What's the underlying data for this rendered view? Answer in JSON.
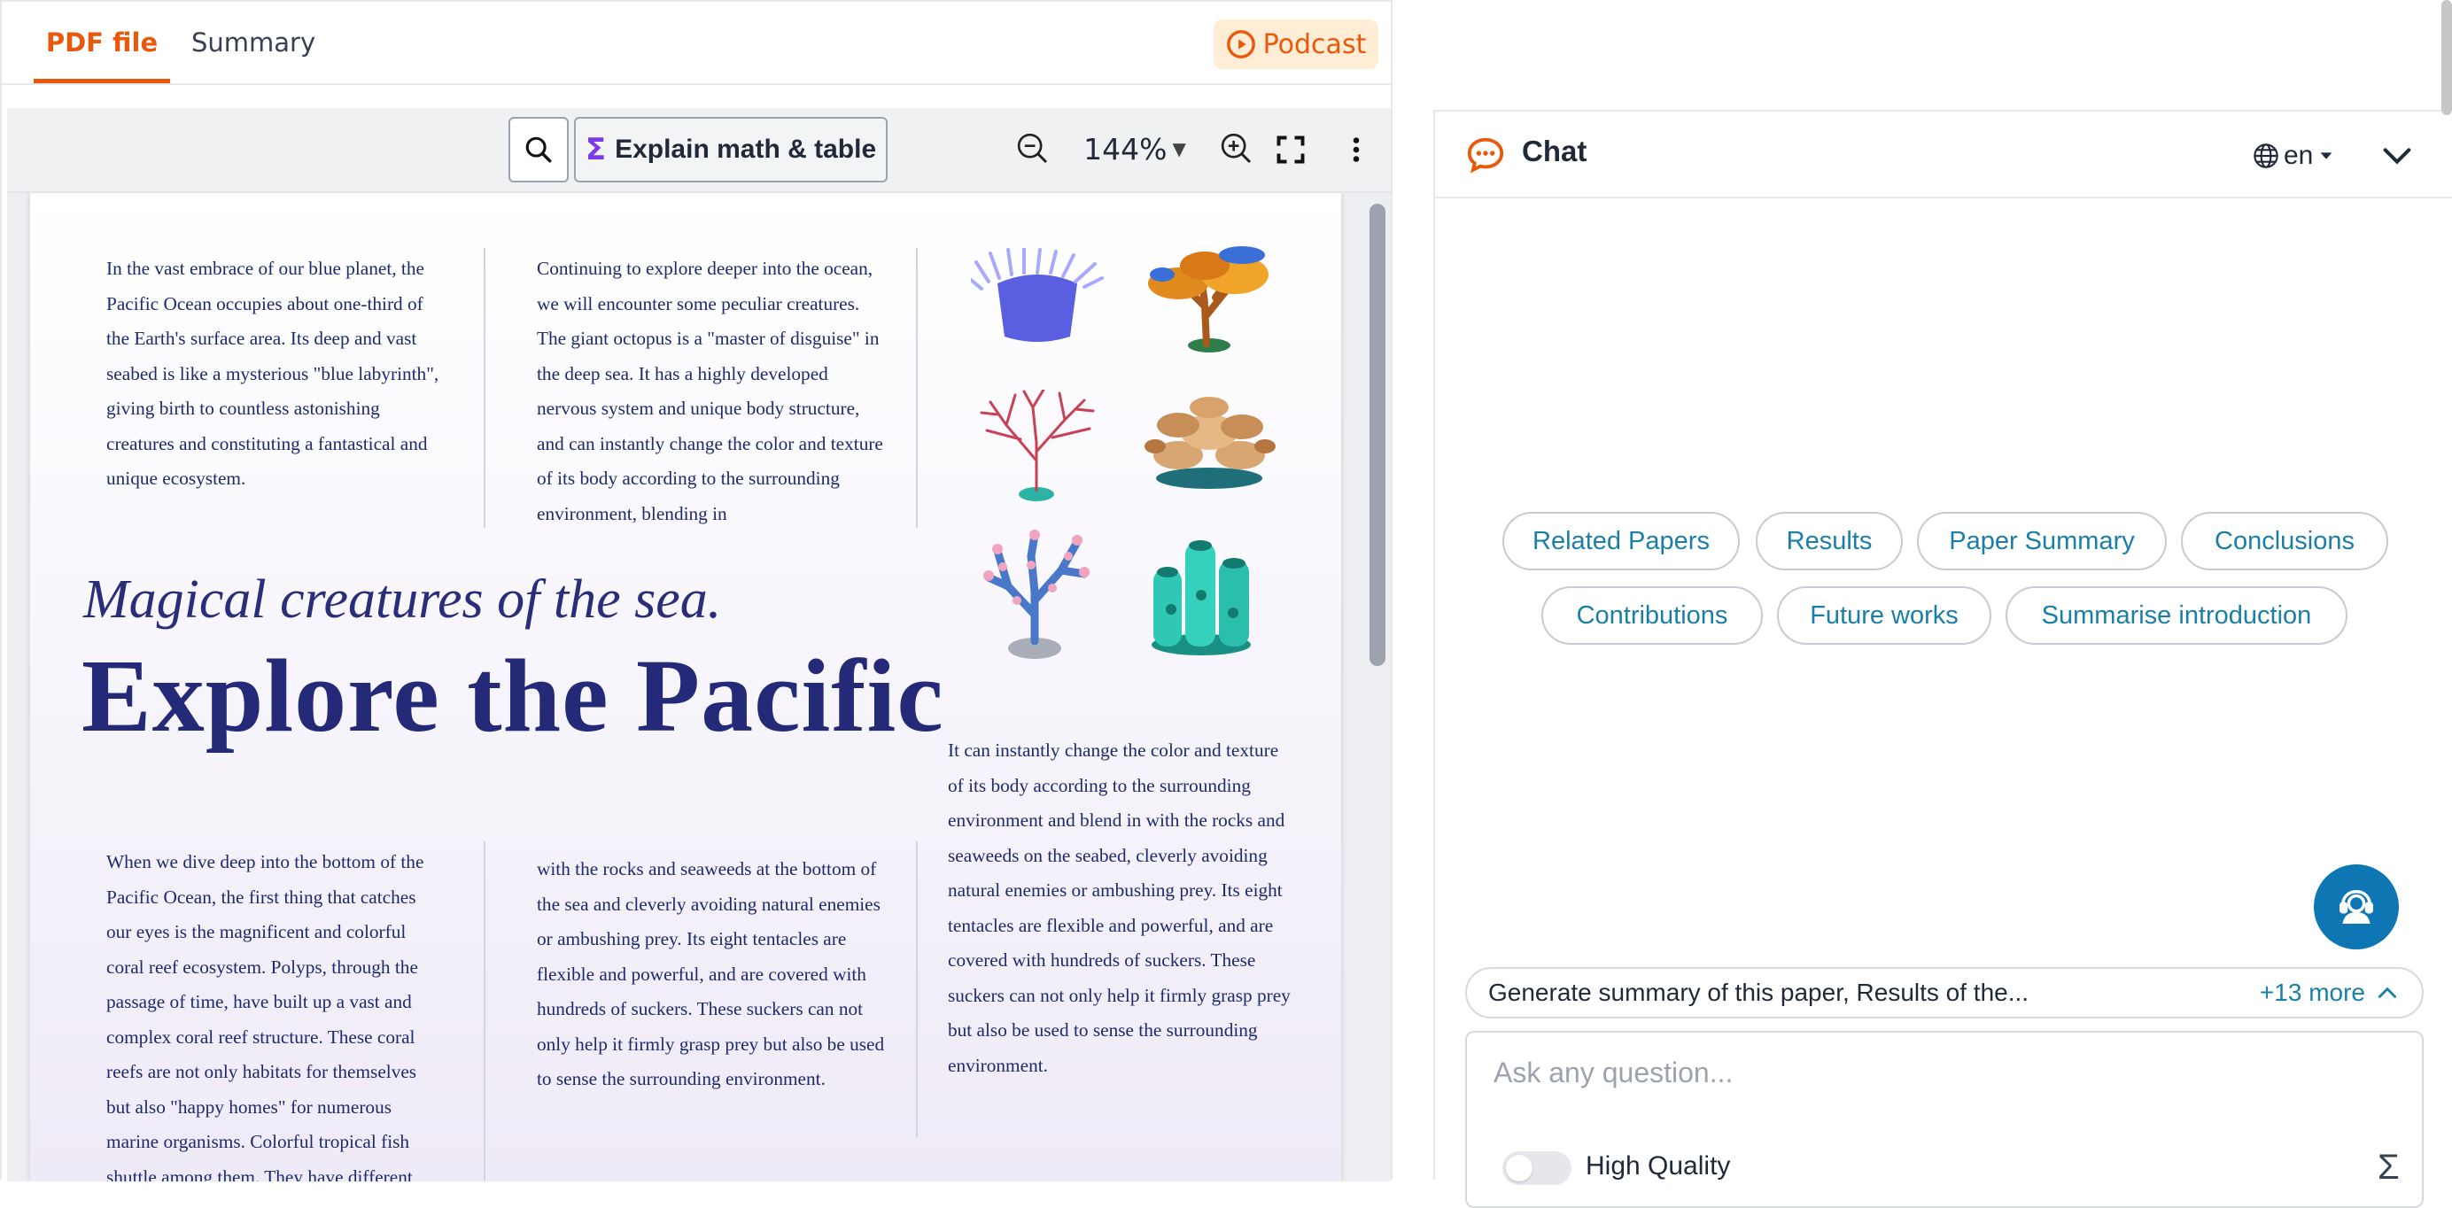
{
  "tabs": {
    "pdf": "PDF file",
    "summary": "Summary"
  },
  "podcast_label": "Podcast",
  "toolbar": {
    "explain_label": "Explain math & table",
    "zoom": "144%",
    "zoom_caret": "▼"
  },
  "document": {
    "col1_top": "In the vast embrace of our blue planet, the Pacific Ocean occupies about one-third of the Earth's surface area. Its deep and vast seabed is like a mysterious \"blue labyrinth\", giving birth to countless astonishing creatures and constituting a fantastical and unique ecosystem.",
    "col2_top": "Continuing to explore deeper into the ocean, we will encounter some peculiar creatures. The giant octopus is a \"master of disguise\" in the deep sea. It has a highly developed nervous system and unique body structure, and can instantly change the color and texture of its body according to the surrounding environment, blending in",
    "subtitle": "Magical creatures of the sea.",
    "headline": "Explore the Pacific",
    "col3_mid": "It can instantly change the color and texture of its body according to the surrounding environment and blend in with the rocks and seaweeds on the seabed, cleverly avoiding natural enemies or ambushing prey. Its eight tentacles are flexible and powerful, and are covered with hundreds of suckers. These suckers can not only help it firmly grasp prey but also be used to sense the surrounding environment.",
    "col1_bottom": "When we dive deep into the bottom of the Pacific Ocean, the first thing that catches our eyes is the magnificent and colorful coral reef ecosystem. Polyps, through the passage of time, have built up a vast and complex coral reef structure. These coral reefs are not only habitats for themselves but also \"happy homes\" for numerous marine organisms. Colorful tropical fish shuttle among them. They have different",
    "col2_bottom": "with the rocks and seaweeds at the bottom of the sea and cleverly avoiding natural enemies or ambushing prey. Its eight tentacles are flexible and powerful, and are covered with hundreds of suckers. These suckers can not only help it firmly grasp prey but also be used to sense the surrounding environment."
  },
  "chat": {
    "title": "Chat",
    "lang": "en",
    "chips": [
      "Related Papers",
      "Results",
      "Paper Summary",
      "Conclusions",
      "Contributions",
      "Future works",
      "Summarise introduction"
    ],
    "suggestion": "Generate summary of this paper, Results of the...",
    "more": "+13 more",
    "placeholder": "Ask any question...",
    "hq_label": "High Quality",
    "sigma": "Σ"
  },
  "colors": {
    "accent": "#ea580c",
    "link": "#1a7fa8",
    "support": "#0e76b3",
    "headline": "#242a78"
  },
  "icons": [
    "play-circle-icon",
    "search-icon",
    "sigma-icon",
    "zoom-out-icon",
    "zoom-in-icon",
    "fullscreen-icon",
    "more-vertical-icon",
    "chat-bubble-icon",
    "globe-icon",
    "chevron-down-icon",
    "support-agent-icon",
    "chevron-up-icon"
  ]
}
